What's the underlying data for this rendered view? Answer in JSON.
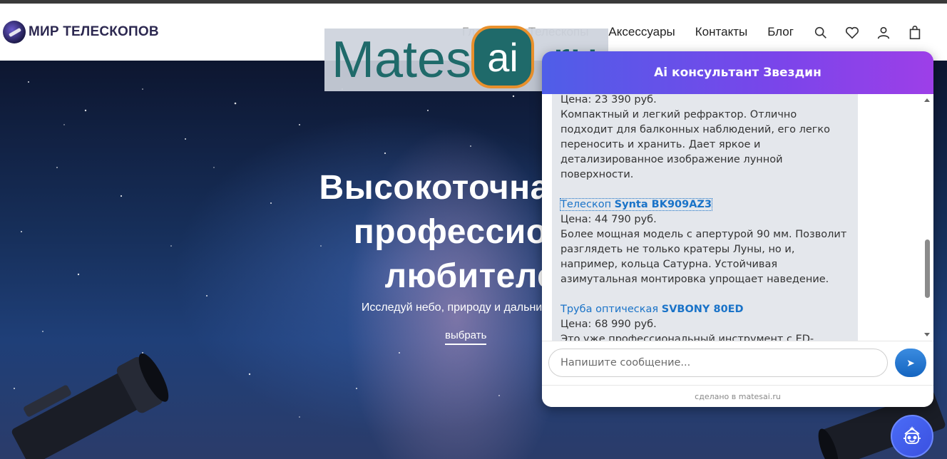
{
  "site": {
    "logo_text": "МИР ТЕЛЕСКОПОВ",
    "nav": [
      "Главная",
      "Телескопы",
      "Аксессуары",
      "Контакты",
      "Блог"
    ]
  },
  "icons": {
    "search": "search-icon",
    "wishlist": "heart-icon",
    "account": "user-icon",
    "cart": "shopping-bag-icon"
  },
  "hero": {
    "title_lines": [
      "Высокоточная оп",
      "профессиона",
      "любителе"
    ],
    "subtitle": "Исследуй небо, природу и дальние гориз",
    "button": "выбрать"
  },
  "watermark": {
    "left": "Mates",
    "badge": "ai",
    "right": ".ru"
  },
  "chat": {
    "title": "Ai консультант Звездин",
    "messages": {
      "first_price": "Цена: 23 390 руб.",
      "first_desc": "Компактный и легкий рефрактор. Отлично подходит для балконных наблюдений, его легко переносить и хранить. Дает яркое и детализированное изображение лунной поверхности.",
      "product2_prefix": "Телескоп ",
      "product2_name": "Synta BK909AZ3",
      "product2_price": "Цена: 44 790 руб.",
      "product2_desc": "Более мощная модель с апертурой 90 мм. Позволит разглядеть не только кратеры Луны, но и, например, кольца Сатурна. Устойчивая азимутальная монтировка упрощает наведение.",
      "product3_prefix": "Труба оптическая ",
      "product3_name": "SVBONY 80ED",
      "product3_price": "Цена: 68 990 руб.",
      "product3_desc": "Это уже профессиональный инструмент с ED-стеклом, которое практически полностью устраняет"
    },
    "input_placeholder": "Напишите сообщение...",
    "send_icon": "➤",
    "footer": "сделано в matesai.ru"
  },
  "colors": {
    "chat_header_start": "#4f5ee8",
    "chat_header_end": "#9d3fe8",
    "link": "#1a73c8",
    "watermark_teal": "#1f6a6a",
    "watermark_orange": "#e8902c"
  },
  "fab_icon": "assistant-robot-icon"
}
